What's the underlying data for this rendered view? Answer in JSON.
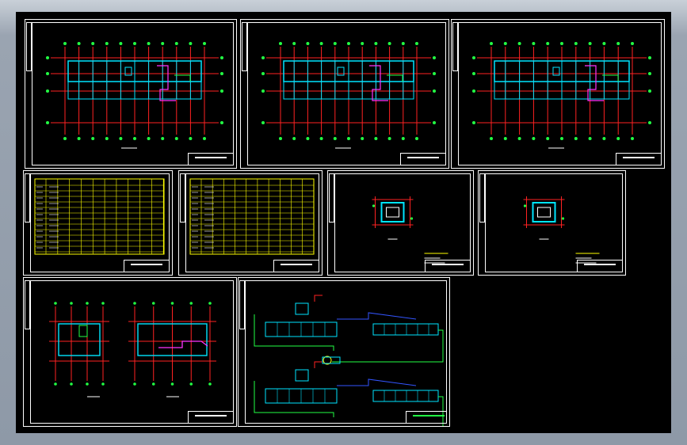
{
  "cad_view": {
    "background_color": "#000000",
    "line_colors": {
      "frame": "#ffffff",
      "grid_axis": "#ff2222",
      "grid_bubble": "#22ff44",
      "walls": "#00e5ff",
      "equipment": "#ff33ff",
      "table_lines": "#ffff00",
      "schematic_pipe": "#22ff44",
      "schematic_blue": "#3355ff"
    }
  },
  "sheets": [
    {
      "id": "sheet-1",
      "kind": "floor-plan"
    },
    {
      "id": "sheet-2",
      "kind": "floor-plan"
    },
    {
      "id": "sheet-3",
      "kind": "floor-plan"
    },
    {
      "id": "sheet-4",
      "kind": "table"
    },
    {
      "id": "sheet-5",
      "kind": "table"
    },
    {
      "id": "sheet-6",
      "kind": "detail"
    },
    {
      "id": "sheet-7",
      "kind": "detail"
    },
    {
      "id": "sheet-8",
      "kind": "partial-plans"
    },
    {
      "id": "sheet-9",
      "kind": "system-schematic"
    }
  ]
}
